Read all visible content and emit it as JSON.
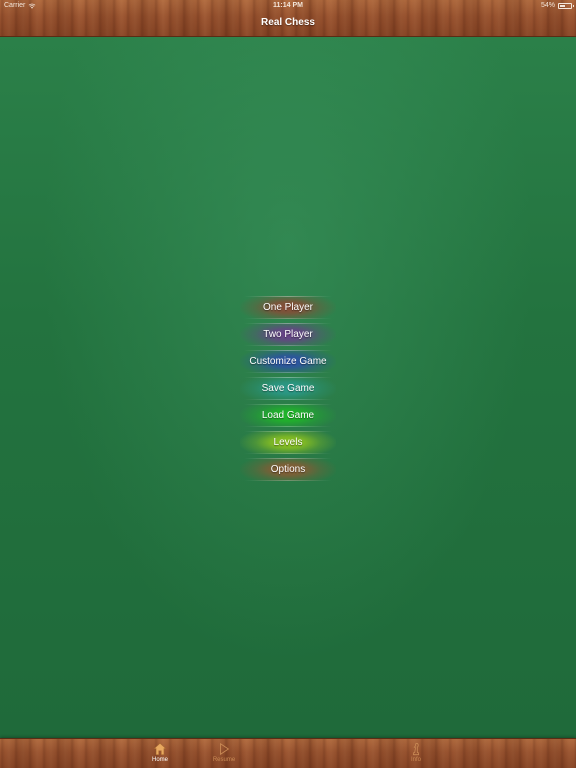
{
  "status_bar": {
    "carrier": "Carrier",
    "time": "11:14 PM",
    "battery": "54%",
    "battery_level": 0.54
  },
  "nav": {
    "title": "Real Chess"
  },
  "menu": {
    "items": [
      {
        "label": "One Player",
        "color": "#8a4a36"
      },
      {
        "label": "Two Player",
        "color": "#6a3f8a"
      },
      {
        "label": "Customize Game",
        "color": "#2c4fa8"
      },
      {
        "label": "Save Game",
        "color": "#2a9a8c"
      },
      {
        "label": "Load Game",
        "color": "#1fb827"
      },
      {
        "label": "Levels",
        "color": "#8fc41f"
      },
      {
        "label": "Options",
        "color": "#8a5a34"
      }
    ]
  },
  "tab_bar": {
    "home_label": "Home",
    "resume_label": "Resume",
    "info_label": "Info",
    "active_color": "#ffffff",
    "inactive_color": "#c98a55"
  }
}
